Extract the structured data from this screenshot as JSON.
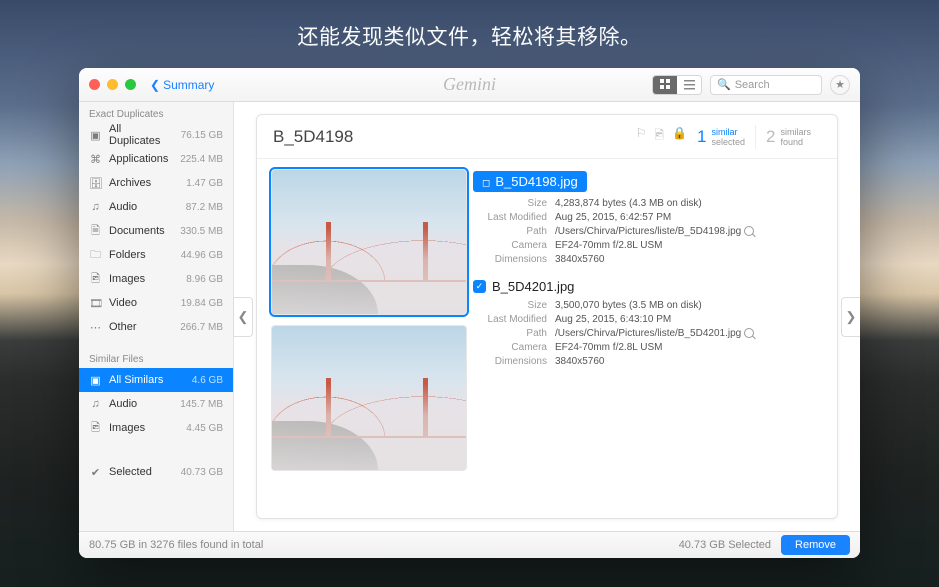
{
  "subtitle": "还能发现类似文件，轻松将其移除。",
  "titlebar": {
    "back_label": "Summary",
    "brand": "Gemini",
    "search_placeholder": "Search"
  },
  "sidebar": {
    "exact_header": "Exact Duplicates",
    "similar_header": "Similar Files",
    "exact": [
      {
        "icon": "▣",
        "label": "All Duplicates",
        "size": "76.15 GB"
      },
      {
        "icon": "⌘",
        "label": "Applications",
        "size": "225.4 MB"
      },
      {
        "icon": "🗄",
        "label": "Archives",
        "size": "1.47 GB"
      },
      {
        "icon": "♫",
        "label": "Audio",
        "size": "87.2 MB"
      },
      {
        "icon": "🗎",
        "label": "Documents",
        "size": "330.5 MB"
      },
      {
        "icon": "🗀",
        "label": "Folders",
        "size": "44.96 GB"
      },
      {
        "icon": "🖻",
        "label": "Images",
        "size": "8.96 GB"
      },
      {
        "icon": "🎞",
        "label": "Video",
        "size": "19.84 GB"
      },
      {
        "icon": "⋯",
        "label": "Other",
        "size": "266.7 MB"
      }
    ],
    "similar": [
      {
        "icon": "▣",
        "label": "All Similars",
        "size": "4.6 GB",
        "active": true
      },
      {
        "icon": "♫",
        "label": "Audio",
        "size": "145.7 MB"
      },
      {
        "icon": "🖻",
        "label": "Images",
        "size": "4.45 GB"
      }
    ],
    "selected": {
      "icon": "✔",
      "label": "Selected",
      "size": "40.73 GB"
    }
  },
  "detail": {
    "title": "B_5D4198",
    "stat_selected": {
      "n": "1",
      "l1": "similar",
      "l2": "selected"
    },
    "stat_found": {
      "n": "2",
      "l1": "similars",
      "l2": "found"
    },
    "files": [
      {
        "name": "B_5D4198.jpg",
        "highlight": true,
        "checked": false,
        "meta": {
          "Size": "4,283,874 bytes (4.3 MB on disk)",
          "Last Modified": "Aug 25, 2015, 6:42:57 PM",
          "Path": "/Users/Chirva/Pictures/liste/B_5D4198.jpg",
          "Camera": "EF24-70mm f/2.8L USM",
          "Dimensions": "3840x5760"
        }
      },
      {
        "name": "B_5D4201.jpg",
        "highlight": false,
        "checked": true,
        "meta": {
          "Size": "3,500,070 bytes (3.5 MB on disk)",
          "Last Modified": "Aug 25, 2015, 6:43:10 PM",
          "Path": "/Users/Chirva/Pictures/liste/B_5D4201.jpg",
          "Camera": "EF24-70mm f/2.8L USM",
          "Dimensions": "3840x5760"
        }
      }
    ]
  },
  "footer": {
    "summary": "80.75 GB in 3276 files found in total",
    "selected": "40.73 GB Selected",
    "remove": "Remove"
  }
}
